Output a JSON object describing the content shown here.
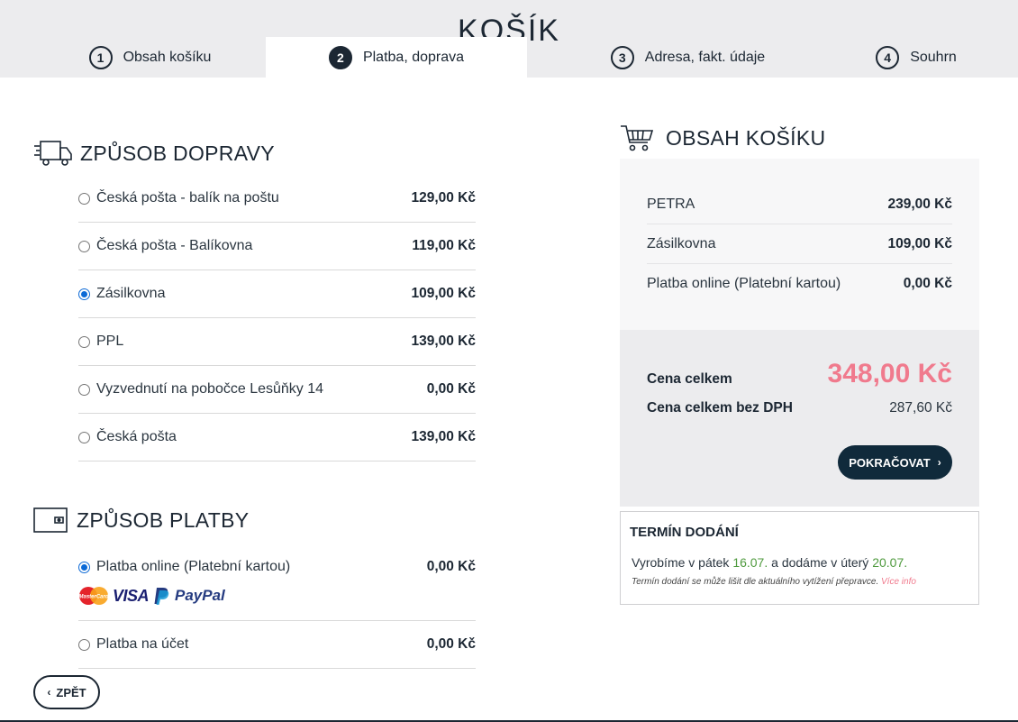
{
  "header": {
    "title": "KOŠÍK",
    "steps": [
      {
        "num": "1",
        "label": "Obsah košíku"
      },
      {
        "num": "2",
        "label": "Platba, doprava"
      },
      {
        "num": "3",
        "label": "Adresa, fakt. údaje"
      },
      {
        "num": "4",
        "label": "Souhrn"
      }
    ]
  },
  "shipping": {
    "title": "ZPŮSOB DOPRAVY",
    "options": [
      {
        "label": "Česká pošta - balík na poštu",
        "price": "129,00 Kč",
        "selected": false
      },
      {
        "label": "Česká pošta - Balíkovna",
        "price": "119,00 Kč",
        "selected": false
      },
      {
        "label": "Zásilkovna",
        "price": "109,00 Kč",
        "selected": true
      },
      {
        "label": "PPL",
        "price": "139,00 Kč",
        "selected": false
      },
      {
        "label": "Vyzvednutí na pobočce Lesůňky 14",
        "price": "0,00 Kč",
        "selected": false
      },
      {
        "label": "Česká pošta",
        "price": "139,00 Kč",
        "selected": false
      }
    ]
  },
  "payment": {
    "title": "ZPŮSOB PLATBY",
    "options": [
      {
        "label": "Platba online (Platební kartou)",
        "price": "0,00 Kč",
        "selected": true
      },
      {
        "label": "Platba na účet",
        "price": "0,00 Kč",
        "selected": false
      }
    ],
    "logos": {
      "mastercard": "MasterCard",
      "visa": "VISA",
      "paypal": "PayPal"
    }
  },
  "back_label": "ZPĚT",
  "cart": {
    "title": "OBSAH KOŠÍKU",
    "items": [
      {
        "label": "PETRA",
        "price": "239,00 Kč"
      },
      {
        "label": "Zásilkovna",
        "price": "109,00 Kč"
      },
      {
        "label": "Platba online (Platební kartou)",
        "price": "0,00 Kč"
      }
    ],
    "total_label": "Cena celkem",
    "total_value": "348,00 Kč",
    "net_label": "Cena celkem bez DPH",
    "net_value": "287,60 Kč",
    "continue_label": "POKRAČOVAT"
  },
  "delivery": {
    "title": "TERMÍN DODÁNÍ",
    "text_a": "Vyrobíme v pátek ",
    "date_a": "16.07.",
    "text_b": " a dodáme v úterý ",
    "date_b": "20.07.",
    "note": "Termín dodání se může lišit dle aktuálního vytížení přepravce. ",
    "more_link": "Více info"
  },
  "colors": {
    "dark": "#1c2733",
    "accent_pink": "#f07a8d",
    "radio_blue": "#0b69d6",
    "date_green": "#4f9a3e"
  }
}
